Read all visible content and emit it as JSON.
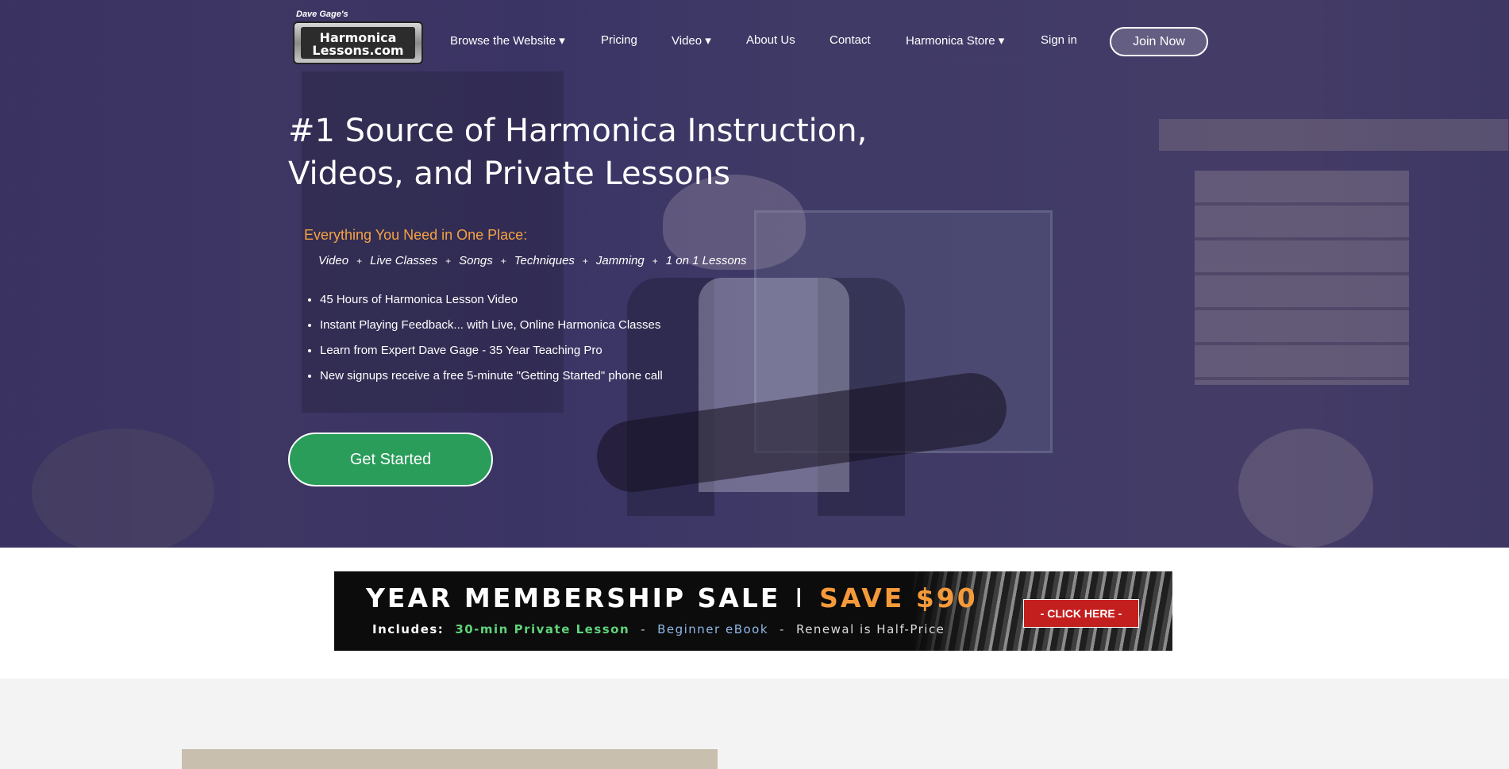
{
  "logo": {
    "top_text": "Dave Gage's",
    "line1": "Harmonica",
    "line2": "Lessons.com"
  },
  "nav": {
    "browse": "Browse the Website ▾",
    "pricing": "Pricing",
    "video": "Video ▾",
    "about": "About Us",
    "contact": "Contact",
    "store": "Harmonica Store ▾",
    "signin": "Sign in",
    "join": "Join Now"
  },
  "hero": {
    "headline_line1": "#1 Source of Harmonica Instruction,",
    "headline_line2": "Videos, and Private Lessons",
    "subhead": "Everything You Need in One Place:",
    "features": [
      "Video",
      "Live Classes",
      "Songs",
      "Techniques",
      "Jamming",
      "1 on 1 Lessons"
    ],
    "feature_separator": "+",
    "bullets": [
      "45 Hours of Harmonica Lesson Video",
      "Instant Playing Feedback... with Live, Online Harmonica Classes",
      "Learn from Expert Dave Gage - 35 Year Teaching Pro",
      "New signups receive a free 5-minute \"Getting Started\" phone call"
    ],
    "cta": "Get Started"
  },
  "banner": {
    "title": "YEAR MEMBERSHIP SALE",
    "divider": "I",
    "save": "SAVE $90",
    "includes_label": "Includes:",
    "item1": "30-min Private Lesson",
    "item2": "Beginner eBook",
    "item3": "Renewal is Half-Price",
    "dash": "-",
    "click": "- CLICK HERE -"
  },
  "colors": {
    "hero_overlay": "#3a346e",
    "cta_green": "#2a9d5a",
    "subhead_orange": "#f5a243",
    "save_orange": "#f59a3a",
    "click_red": "#c41f1f"
  }
}
